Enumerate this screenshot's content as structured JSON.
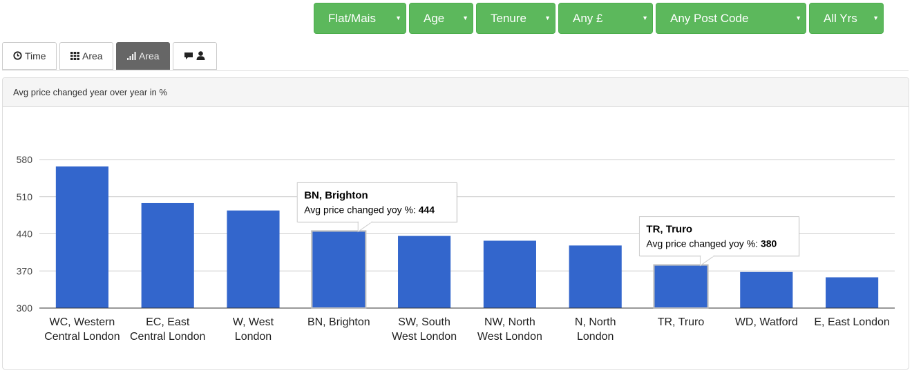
{
  "filters": [
    {
      "label": "Flat/Mais"
    },
    {
      "label": "Age"
    },
    {
      "label": "Tenure"
    },
    {
      "label": "Any £"
    },
    {
      "label": "Any Post Code"
    },
    {
      "label": "All Yrs"
    }
  ],
  "tabs": [
    {
      "label": "Time",
      "icon": "clock-icon"
    },
    {
      "label": "Area",
      "icon": "grid-icon"
    },
    {
      "label": "Area",
      "icon": "bar-chart-icon",
      "active": true
    },
    {
      "label": "",
      "icon": "comment-user-icon"
    }
  ],
  "panel": {
    "title": "Avg price changed year over year in %"
  },
  "chart_data": {
    "type": "bar",
    "title": "Avg price changed year over year in %",
    "categories": [
      [
        "WC, Western",
        "Central London"
      ],
      [
        "EC, East",
        "Central London"
      ],
      [
        "W, West",
        "London"
      ],
      [
        "BN, Brighton"
      ],
      [
        "SW, South",
        "West London"
      ],
      [
        "NW, North",
        "West London"
      ],
      [
        "N, North",
        "London"
      ],
      [
        "TR, Truro"
      ],
      [
        "WD, Watford"
      ],
      [
        "E, East London"
      ]
    ],
    "series": [
      {
        "values": [
          567,
          498,
          484,
          444,
          436,
          427,
          418,
          380,
          368,
          358
        ]
      }
    ],
    "yticks": [
      300,
      370,
      440,
      510,
      580
    ],
    "ylim": [
      300,
      580
    ],
    "grid": true,
    "color": "#3366cc",
    "tooltips": [
      {
        "index": 3,
        "title": "BN, Brighton",
        "label": "Avg price changed yoy %:",
        "value": "444"
      },
      {
        "index": 7,
        "title": "TR, Truro",
        "label": "Avg price changed yoy %:",
        "value": "380"
      }
    ]
  }
}
